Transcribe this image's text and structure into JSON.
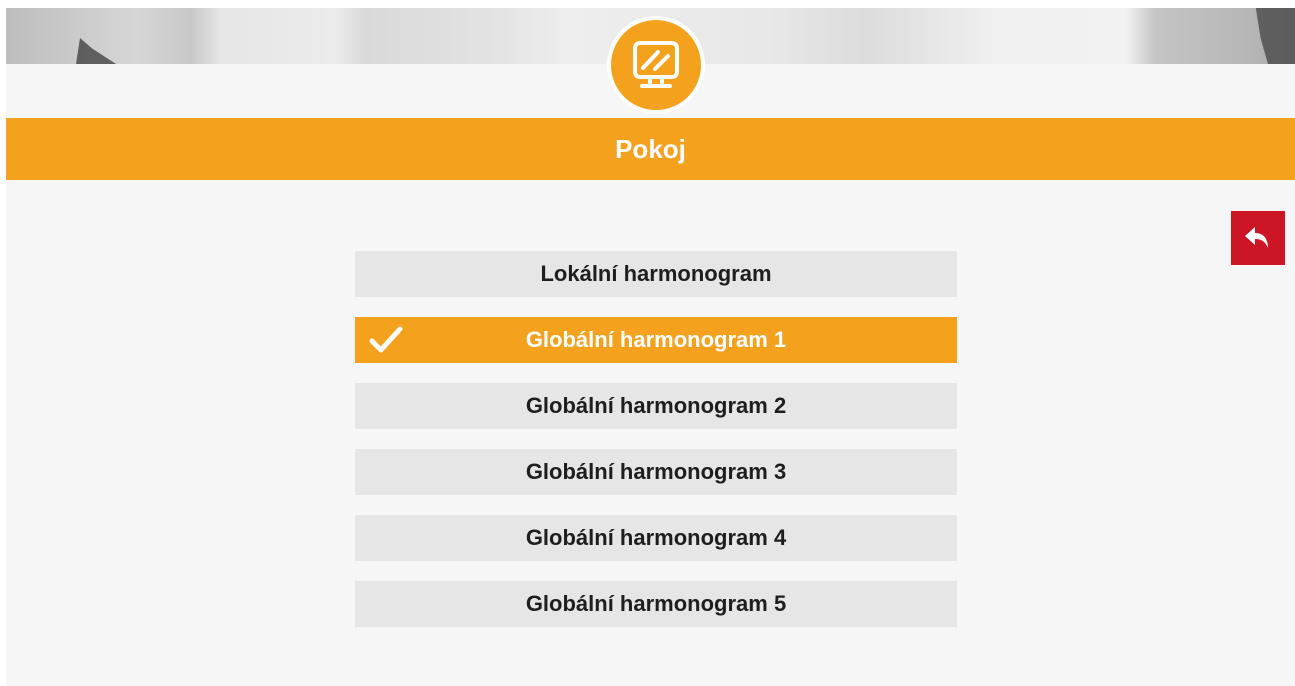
{
  "header": {
    "title": "Pokoj",
    "icon": "monitor-icon"
  },
  "back_button": {
    "icon": "undo-arrow-icon"
  },
  "options": [
    {
      "label": "Lokální harmonogram",
      "selected": false
    },
    {
      "label": "Globální harmonogram 1",
      "selected": true
    },
    {
      "label": "Globální harmonogram 2",
      "selected": false
    },
    {
      "label": "Globální harmonogram 3",
      "selected": false
    },
    {
      "label": "Globální harmonogram 4",
      "selected": false
    },
    {
      "label": "Globální harmonogram 5",
      "selected": false
    }
  ],
  "colors": {
    "accent": "#f4a11e",
    "back_button": "#cc1626",
    "option_bg": "#e6e6e6",
    "background": "#f6f6f6"
  }
}
